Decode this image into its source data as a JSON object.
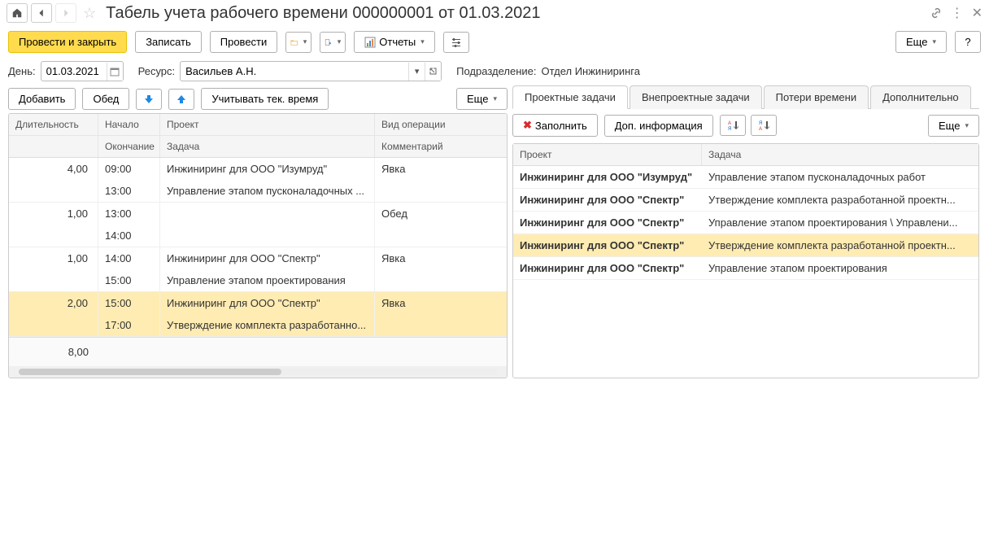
{
  "title": "Табель учета рабочего времени 000000001 от 01.03.2021",
  "toolbar": {
    "post_close": "Провести и закрыть",
    "save": "Записать",
    "post": "Провести",
    "reports": "Отчеты",
    "more": "Еще"
  },
  "fields": {
    "day_label": "День:",
    "day_value": "01.03.2021",
    "resource_label": "Ресурс:",
    "resource_value": "Васильев А.Н.",
    "dept_label": "Подразделение:",
    "dept_value": "Отдел Инжиниринга"
  },
  "left_toolbar": {
    "add": "Добавить",
    "lunch": "Обед",
    "track_time": "Учитывать тек. время",
    "more": "Еще"
  },
  "grid_headers": {
    "duration": "Длительность",
    "start": "Начало",
    "end": "Окончание",
    "project": "Проект",
    "task": "Задача",
    "operation": "Вид операции",
    "comment": "Комментарий"
  },
  "grid_rows": [
    {
      "dur": "4,00",
      "start": "09:00",
      "end": "13:00",
      "project": "Инжиниринг для ООО \"Изумруд\"",
      "task": "Управление этапом пусконаладочных ...",
      "op": "Явка",
      "comment": "",
      "selected": false
    },
    {
      "dur": "1,00",
      "start": "13:00",
      "end": "14:00",
      "project": "",
      "task": "",
      "op": "Обед",
      "comment": "",
      "selected": false
    },
    {
      "dur": "1,00",
      "start": "14:00",
      "end": "15:00",
      "project": "Инжиниринг для ООО \"Спектр\"",
      "task": "Управление этапом проектирования",
      "op": "Явка",
      "comment": "",
      "selected": false
    },
    {
      "dur": "2,00",
      "start": "15:00",
      "end": "17:00",
      "project": "Инжиниринг для ООО \"Спектр\"",
      "task": "Утверждение комплекта разработанно...",
      "op": "Явка",
      "comment": "",
      "selected": true
    }
  ],
  "grid_total": "8,00",
  "tabs": {
    "t1": "Проектные задачи",
    "t2": "Внепроектные задачи",
    "t3": "Потери времени",
    "t4": "Дополнительно"
  },
  "right_toolbar": {
    "fill": "Заполнить",
    "info": "Доп. информация",
    "more": "Еще"
  },
  "rgrid_headers": {
    "project": "Проект",
    "task": "Задача"
  },
  "rgrid_rows": [
    {
      "project": "Инжиниринг для ООО \"Изумруд\"",
      "task": "Управление этапом пусконаладочных работ",
      "selected": false
    },
    {
      "project": "Инжиниринг для ООО \"Спектр\"",
      "task": "Утверждение комплекта разработанной проектн...",
      "selected": false
    },
    {
      "project": "Инжиниринг для ООО \"Спектр\"",
      "task": "Управление этапом проектирования \\ Управлени...",
      "selected": false
    },
    {
      "project": "Инжиниринг для ООО \"Спектр\"",
      "task": "Утверждение комплекта разработанной проектн...",
      "selected": true
    },
    {
      "project": "Инжиниринг для ООО \"Спектр\"",
      "task": "Управление этапом проектирования",
      "selected": false
    }
  ],
  "help": "?"
}
